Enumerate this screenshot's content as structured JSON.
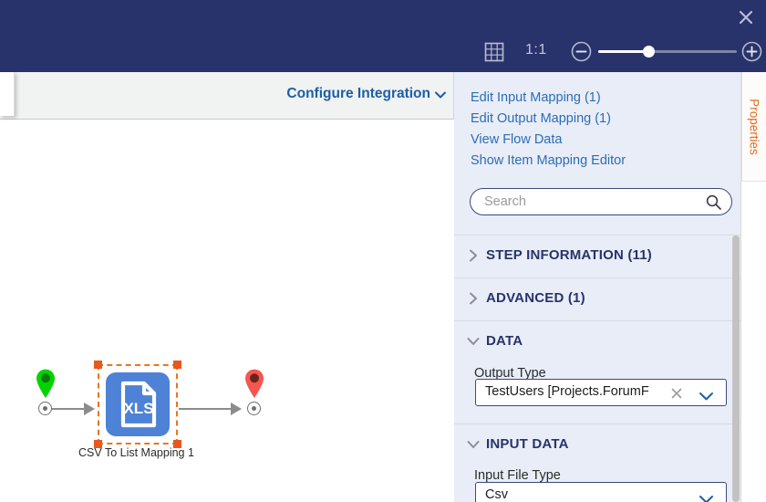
{
  "toolbar": {
    "close_icon": "close-icon",
    "grid_icon": "grid-icon",
    "ratio_label": "1:1",
    "zoom_out_icon": "zoom-out-icon",
    "zoom_in_icon": "zoom-in-icon",
    "zoom_slider_percent": 36
  },
  "canvas_header": {
    "configure_label": "Configure Integration",
    "chevron_icon": "chevron-down-icon"
  },
  "canvas": {
    "start_pin": "start-pin-icon",
    "end_pin": "end-pin-icon",
    "node": {
      "icon_label": "XLS",
      "label": "CSV To List Mapping 1",
      "selected": true
    }
  },
  "properties": {
    "tab_label": "Properties",
    "links": [
      {
        "label": "Edit Input Mapping (1)"
      },
      {
        "label": "Edit Output Mapping (1)"
      },
      {
        "label": "View Flow Data"
      },
      {
        "label": "Show Item Mapping Editor"
      }
    ],
    "search": {
      "value": "",
      "placeholder": "Search",
      "icon": "search-icon"
    },
    "sections": [
      {
        "title": "STEP INFORMATION (11)",
        "expanded": false
      },
      {
        "title": "ADVANCED (1)",
        "expanded": false
      },
      {
        "title": "DATA",
        "expanded": true
      },
      {
        "title": "INPUT DATA",
        "expanded": true
      }
    ],
    "data_section": {
      "output_type_label": "Output Type",
      "output_type_value": "TestUsers   [Projects.ForumF",
      "clear_icon": "close-icon",
      "caret_icon": "chevron-down-icon"
    },
    "input_data_section": {
      "input_file_type_label": "Input File Type",
      "input_file_type_value": "Csv",
      "caret_icon": "chevron-down-icon"
    }
  },
  "colors": {
    "topbar": "#28336b",
    "panel_bg": "#e9edf7",
    "link": "#2a6db5",
    "accent_orange": "#e8681e",
    "node_blue": "#4d82d6",
    "start_pin": "#00d400",
    "end_pin": "#f4574f"
  }
}
